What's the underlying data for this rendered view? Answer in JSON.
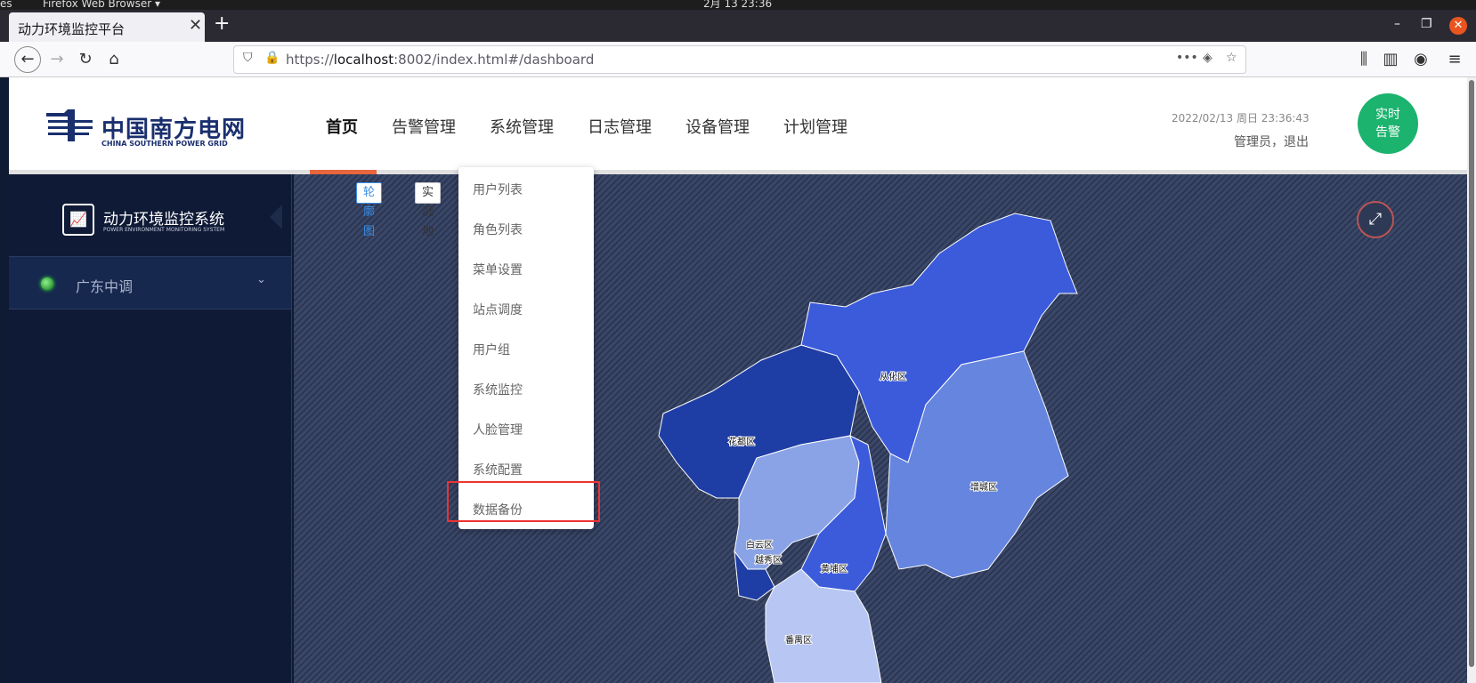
{
  "os": {
    "left_fragment": "es",
    "app_menu": "Firefox Web Browser ▾",
    "clock": "2月 13  23:36"
  },
  "browser": {
    "tab_title": "动力环境监控平台",
    "url_prefix": "https://",
    "url_host": "localhost",
    "url_rest": ":8002/index.html#/dashboard"
  },
  "header": {
    "logo_cn": "中国南方电网",
    "logo_en": "CHINA SOUTHERN POWER GRID",
    "menu": [
      "首页",
      "告警管理",
      "系统管理",
      "日志管理",
      "设备管理",
      "计划管理"
    ],
    "datetime": "2022/02/13   周日   23:36:43",
    "user_links": "管理员，退出",
    "alarm_line1": "实时",
    "alarm_line2": "告警"
  },
  "sidebar": {
    "system_title": "动力环境监控系统",
    "system_subtitle": "POWER ENVIRONMENT MONITORING SYSTEM",
    "region": "广东中调"
  },
  "map": {
    "toggle_outline": "轮廓图",
    "toggle_real": "实况地",
    "districts": [
      {
        "name": "从化区",
        "color": "#3b5bdb"
      },
      {
        "name": "花都区",
        "color": "#1f3ea5"
      },
      {
        "name": "增城区",
        "color": "#6585df"
      },
      {
        "name": "白云区",
        "color": "#8aa3e6"
      },
      {
        "name": "越秀区",
        "color": "#1f3ea5"
      },
      {
        "name": "黄埔区",
        "color": "#3b5bdb"
      },
      {
        "name": "番禺区",
        "color": "#b7c6f2"
      }
    ]
  },
  "dropdown": {
    "items": [
      "用户列表",
      "角色列表",
      "菜单设置",
      "站点调度",
      "用户组",
      "系统监控",
      "人脸管理",
      "系统配置",
      "数据备份"
    ]
  },
  "colors": {
    "accent_green": "#1bb36e",
    "active_indicator": "#e8663d",
    "highlight_red": "#e33333"
  }
}
